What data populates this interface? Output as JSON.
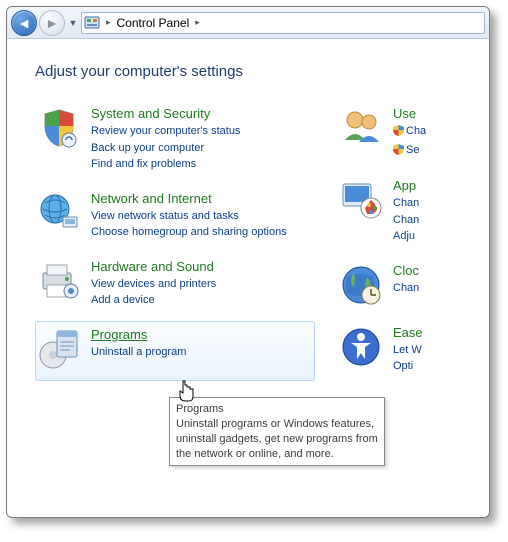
{
  "breadcrumb": {
    "root": "Control Panel"
  },
  "heading": "Adjust your computer's settings",
  "categories_left": [
    {
      "title": "System and Security",
      "links": [
        "Review your computer's status",
        "Back up your computer",
        "Find and fix problems"
      ]
    },
    {
      "title": "Network and Internet",
      "links": [
        "View network status and tasks",
        "Choose homegroup and sharing options"
      ]
    },
    {
      "title": "Hardware and Sound",
      "links": [
        "View devices and printers",
        "Add a device"
      ]
    },
    {
      "title": "Programs",
      "links": [
        "Uninstall a program"
      ]
    }
  ],
  "categories_right": [
    {
      "title": "Use",
      "links": [
        "Cha",
        "Se"
      ]
    },
    {
      "title": "App",
      "links": [
        "Chan",
        "Chan",
        "Adju"
      ]
    },
    {
      "title": "Cloc",
      "links": [
        "Chan"
      ]
    },
    {
      "title": "Ease",
      "links": [
        "Let W",
        "Opti"
      ]
    }
  ],
  "tooltip": {
    "title": "Programs",
    "body": "Uninstall programs or Windows features, uninstall gadgets, get new programs from the network or online, and more."
  }
}
